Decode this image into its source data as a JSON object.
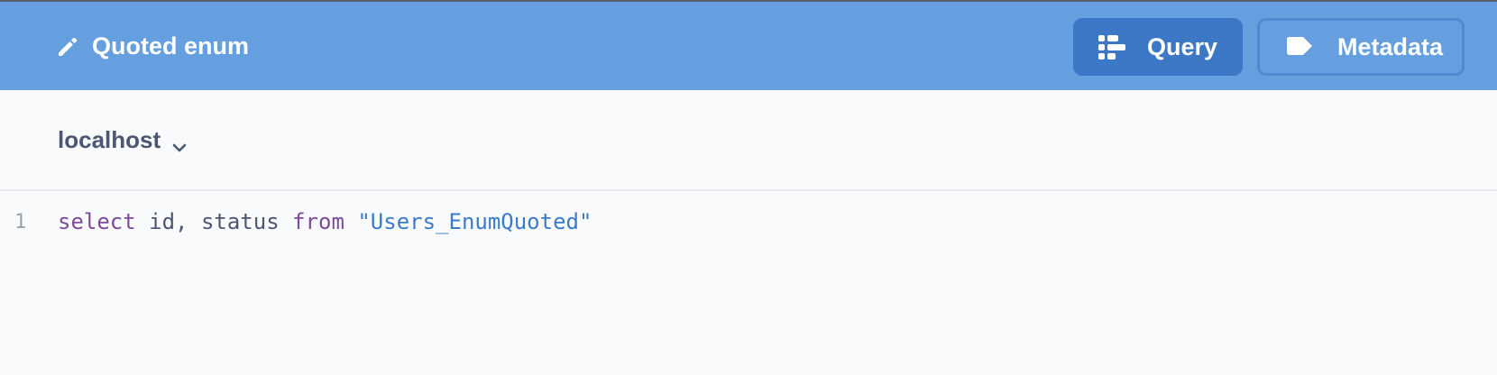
{
  "header": {
    "title": "Quoted enum",
    "title_icon": "pencil-icon",
    "query_label": "Query",
    "query_icon": "list-icon",
    "metadata_label": "Metadata",
    "metadata_icon": "tag-icon",
    "colors": {
      "bar": "#659fdf",
      "active_button": "#3c78c6"
    }
  },
  "database": {
    "selected": "localhost",
    "icon": "chevron-down-icon"
  },
  "editor": {
    "lines": [
      {
        "number": "1",
        "tokens": [
          {
            "text": "select",
            "kind": "keyword"
          },
          {
            "text": " id, status ",
            "kind": "plain"
          },
          {
            "text": "from",
            "kind": "keyword"
          },
          {
            "text": " ",
            "kind": "plain"
          },
          {
            "text": "\"Users_EnumQuoted\"",
            "kind": "string"
          }
        ]
      }
    ]
  }
}
